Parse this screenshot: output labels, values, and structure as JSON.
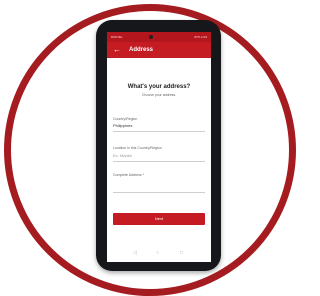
{
  "statusbar": {
    "left": "DIGITEL",
    "right": "87% 2:03"
  },
  "appbar": {
    "title": "Address",
    "back_icon": "←"
  },
  "heading": "What's your address?",
  "subheading": "Choose your address.",
  "fields": {
    "country_label": "Country/Region",
    "country_value": "Philippines",
    "location_label": "Location in this Country/Region",
    "location_placeholder": "Ex. Manila",
    "address_label": "Complete Address *"
  },
  "next_label": "Next",
  "navbar": {
    "back": "◁",
    "home": "○",
    "recent": "□"
  },
  "colors": {
    "accent": "#c51b23",
    "ring": "#a51c20"
  }
}
